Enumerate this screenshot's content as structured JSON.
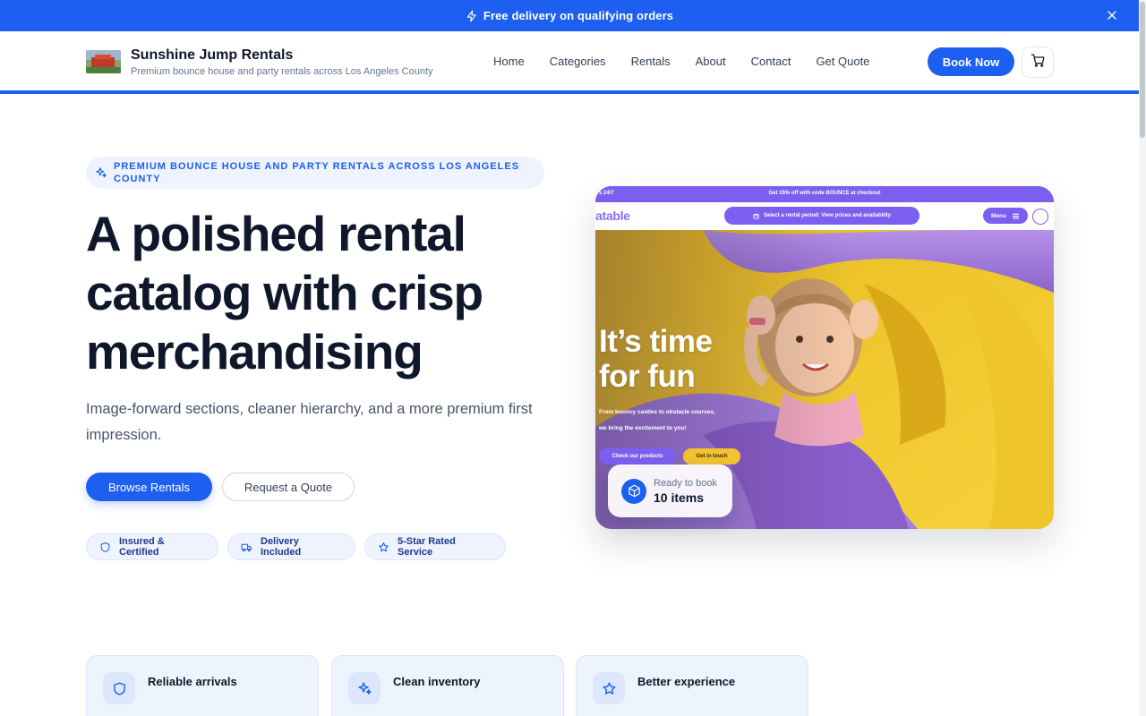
{
  "announcement": {
    "text": "Free delivery on qualifying orders"
  },
  "header": {
    "brand_name": "Sunshine Jump Rentals",
    "brand_tagline": "Premium bounce house and party rentals across Los Angeles County",
    "nav": [
      "Home",
      "Categories",
      "Rentals",
      "About",
      "Contact",
      "Get Quote"
    ],
    "book_label": "Book Now"
  },
  "hero": {
    "eyebrow": "PREMIUM BOUNCE HOUSE AND PARTY RENTALS ACROSS LOS ANGELES COUNTY",
    "title": "A polished rental catalog with crisp merchandising",
    "subtitle": "Image-forward sections, cleaner hierarchy, and a more premium first impression.",
    "primary_cta": "Browse Rentals",
    "secondary_cta": "Request a Quote",
    "badges": [
      "Insured & Certified",
      "Delivery Included",
      "5-Star Rated Service"
    ]
  },
  "preview": {
    "topbar_left": "s 24/7",
    "topbar_center": "Get 15% off with code BOUNCE at checkout",
    "logo_text": "atable",
    "period_label": "Select a rental period: View prices and availability",
    "menu_label": "Menu",
    "headline_line1": "It’s time",
    "headline_line2": "for fun",
    "copy_line1": "From bouncy castles to obstacle courses,",
    "copy_line2": "we bring the excitement to you!",
    "cta_products": "Check our products",
    "cta_touch": "Get in touch"
  },
  "ready": {
    "label": "Ready to book",
    "value": "10 items"
  },
  "features": [
    "Reliable arrivals",
    "Clean inventory",
    "Better experience"
  ],
  "colors": {
    "accent": "#1d5ff0",
    "preview_purple": "#7c5ff0",
    "preview_yellow": "#f2c233"
  }
}
